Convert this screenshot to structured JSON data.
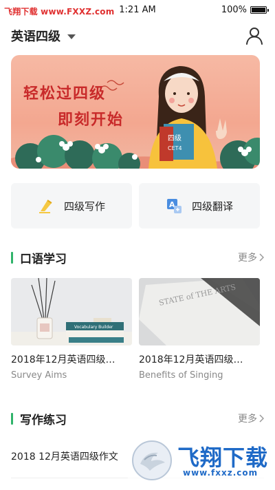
{
  "status_bar": {
    "watermark": "飞翔下载 www.FXXZ.com",
    "time": "1:21 AM",
    "battery": "100%",
    "battery_level": 1.0
  },
  "header": {
    "level": "英语四级",
    "icons": {
      "dropdown": "caret-down-icon",
      "profile": "user-icon"
    }
  },
  "banner": {
    "line1": "轻松过四级",
    "line2": "即刻开始",
    "book_text": "四级",
    "book_sub": "CET4"
  },
  "quick_actions": [
    {
      "label": "四级写作",
      "icon": "pen-icon"
    },
    {
      "label": "四级翻译",
      "icon": "translate-icon"
    }
  ],
  "oral_section": {
    "title": "口语学习",
    "more": "更多",
    "cards": [
      {
        "title": "2018年12月英语四级…",
        "subtitle": "Survey Aims",
        "book_label": "Vocabulary Builder"
      },
      {
        "title": "2018年12月英语四级…",
        "subtitle": "Benefits of Singing",
        "cover_text": "STATE of THE ARTS"
      }
    ]
  },
  "writing_section": {
    "title": "写作练习",
    "more": "更多",
    "items": [
      {
        "title": "2018 12月英语四级作文"
      }
    ]
  },
  "watermark_bottom": {
    "title": "飞翔下载",
    "url": "www.fxxz.com"
  },
  "colors": {
    "accent_green": "#2fb36a",
    "banner_bg": "#f3a790",
    "banner_text": "#c82a2a",
    "watermark_blue": "#1f6ac7"
  }
}
